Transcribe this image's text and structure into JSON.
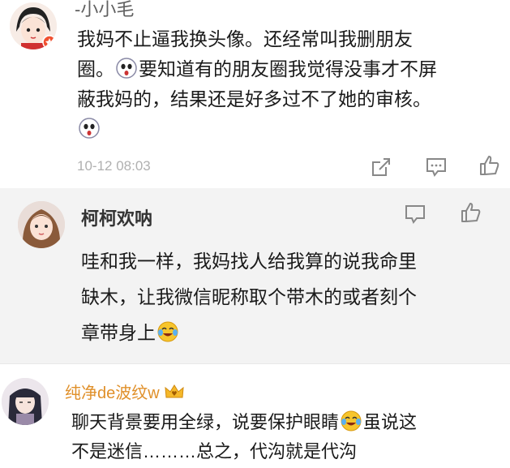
{
  "comments": [
    {
      "username": "-小小毛",
      "lines": [
        {
          "text": "我妈不止逼我换头像。还经常叫我删朋友"
        },
        {
          "text": "圈。",
          "emoji": "surprised-face-emoji",
          "after": "要知道有的朋友圈我觉得没事才不屏"
        },
        {
          "text": "蔽我妈的，结果还是好多过不了她的审核。"
        },
        {
          "text": "",
          "emoji": "surprised-face-emoji",
          "after": ""
        }
      ],
      "timestamp": "10-12 08:03",
      "actions": [
        "share-icon",
        "comment-icon",
        "like-icon"
      ]
    },
    {
      "username": "柯柯欢呐",
      "lines": [
        {
          "text": "哇和我一样，我妈找人给我算的说我命里"
        },
        {
          "text": "缺木，让我微信昵称取个带木的或者刻个"
        },
        {
          "text": "章带身上",
          "emoji": "laughing-tears-emoji",
          "after": ""
        }
      ],
      "actions": [
        "comment-icon",
        "like-icon"
      ]
    },
    {
      "username": "纯净de波纹w",
      "badge": "crown-badge-icon",
      "lines": [
        {
          "text": "聊天背景要用全绿，说要保护眼睛",
          "emoji": "laughing-tears-emoji",
          "after": "虽说这"
        },
        {
          "text": "不是迷信………总之，代沟就是代沟"
        }
      ]
    }
  ],
  "colors": {
    "name": "#555555",
    "text": "#1a1a1a",
    "timestamp": "#b0b0b0",
    "reply_bg": "#f3f3f3",
    "badge": "#f0a020"
  }
}
